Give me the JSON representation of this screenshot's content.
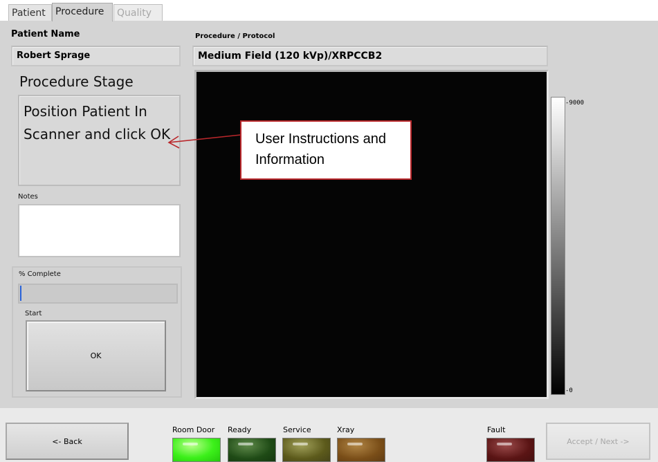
{
  "tabs": [
    {
      "label": "Patient",
      "state": "inactive"
    },
    {
      "label": "Procedure",
      "state": "active"
    },
    {
      "label": "Quality",
      "state": "disabled"
    }
  ],
  "patient": {
    "name_label": "Patient Name",
    "name_value": "Robert Sprage"
  },
  "procedure": {
    "label": "Procedure / Protocol",
    "value": "Medium Field (120 kVp)/XRPCCB2"
  },
  "stage": {
    "title": "Procedure Stage",
    "message": "Position Patient In Scanner and click OK"
  },
  "notes": {
    "label": "Notes",
    "value": ""
  },
  "progress": {
    "label": "% Complete",
    "value_fraction": 0.0
  },
  "start": {
    "label": "Start",
    "ok_label": "OK"
  },
  "colorbar": {
    "max_label": "9000",
    "min_label": "0"
  },
  "annotation": {
    "text": "User Instructions and Information",
    "border_color": "#b9272b"
  },
  "buttons": {
    "back_label": "<- Back",
    "accept_label": "Accept / Next ->"
  },
  "indicators": [
    {
      "label": "Room Door",
      "state": "on",
      "color": "#3cf01a"
    },
    {
      "label": "Ready",
      "state": "off",
      "color": "#1f4b16"
    },
    {
      "label": "Service",
      "state": "off",
      "color": "#5c5a1b"
    },
    {
      "label": "Xray",
      "state": "off",
      "color": "#7a4e18"
    },
    {
      "label": "Fault",
      "state": "off",
      "color": "#5a1414"
    }
  ]
}
